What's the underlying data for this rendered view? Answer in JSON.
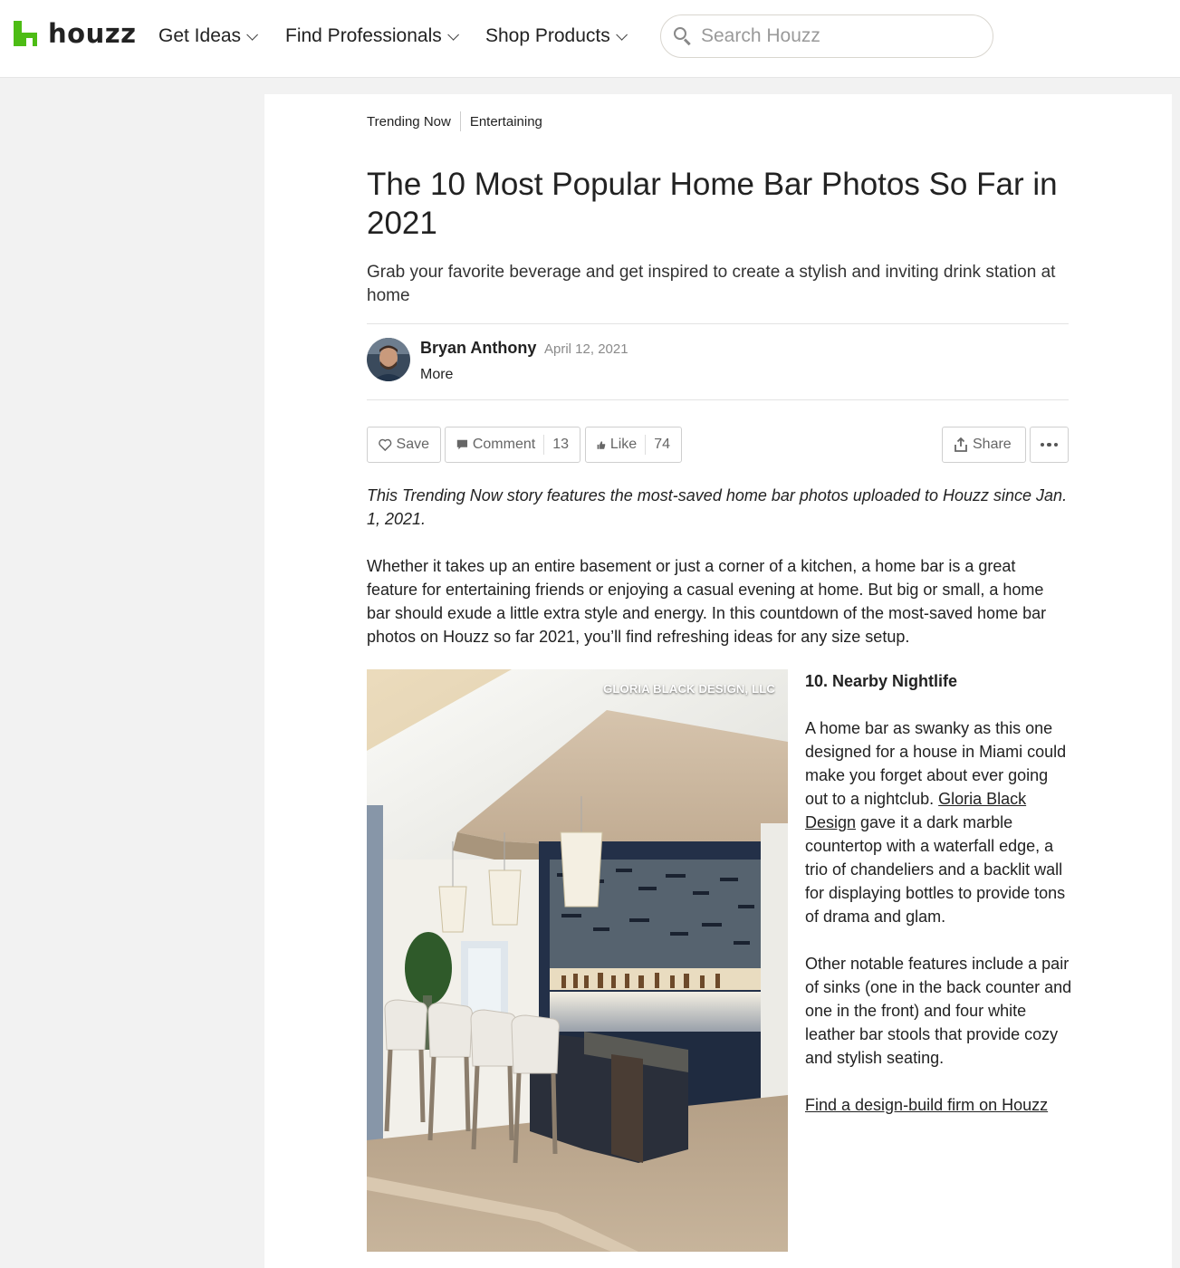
{
  "header": {
    "logo_text": "houzz",
    "nav": [
      {
        "label": "Get Ideas"
      },
      {
        "label": "Find Professionals"
      },
      {
        "label": "Shop Products"
      }
    ],
    "search_placeholder": "Search Houzz"
  },
  "article": {
    "breadcrumbs": [
      "Trending Now",
      "Entertaining"
    ],
    "title": "The 10 Most Popular Home Bar Photos So Far in 2021",
    "subtitle": "Grab your favorite beverage and get inspired to create a stylish and inviting drink station at home",
    "author": {
      "name": "Bryan Anthony",
      "date": "April 12, 2021",
      "more_label": "More"
    },
    "actions": {
      "save_label": "Save",
      "comment_label": "Comment",
      "comment_count": "13",
      "like_label": "Like",
      "like_count": "74",
      "share_label": "Share"
    },
    "intro": "This Trending Now story features the most-saved home bar photos uploaded to Houzz since Jan. 1, 2021.",
    "body": "Whether it takes up an entire basement or just a corner of a kitchen, a home bar is a great feature for entertaining friends or enjoying a casual evening at home. But big or small, a home bar should exude a little extra style and energy. In this countdown of the most-saved home bar photos on Houzz so far 2021, you’ll find refreshing ideas for any size setup.",
    "photo": {
      "credit": "GLORIA BLACK DESIGN, LLC"
    },
    "entry": {
      "heading": "10. Nearby Nightlife",
      "para1_before": "A home bar as swanky as this one designed for a house in Miami could make you forget about ever going out to a nightclub. ",
      "para1_link": "Gloria Black Design",
      "para1_after": " gave it a dark marble countertop with a waterfall edge, a trio of chandeliers and a backlit wall for displaying bottles to provide tons of drama and glam.",
      "para2": "Other notable features include a pair of sinks (one in the back counter and one in the front) and four white leather bar stools that provide cozy and stylish seating.",
      "cta_link": "Find a design-build firm on Houzz"
    }
  },
  "colors": {
    "brand_green": "#4dbc15",
    "text": "#222222",
    "muted": "#8a8a8a"
  }
}
